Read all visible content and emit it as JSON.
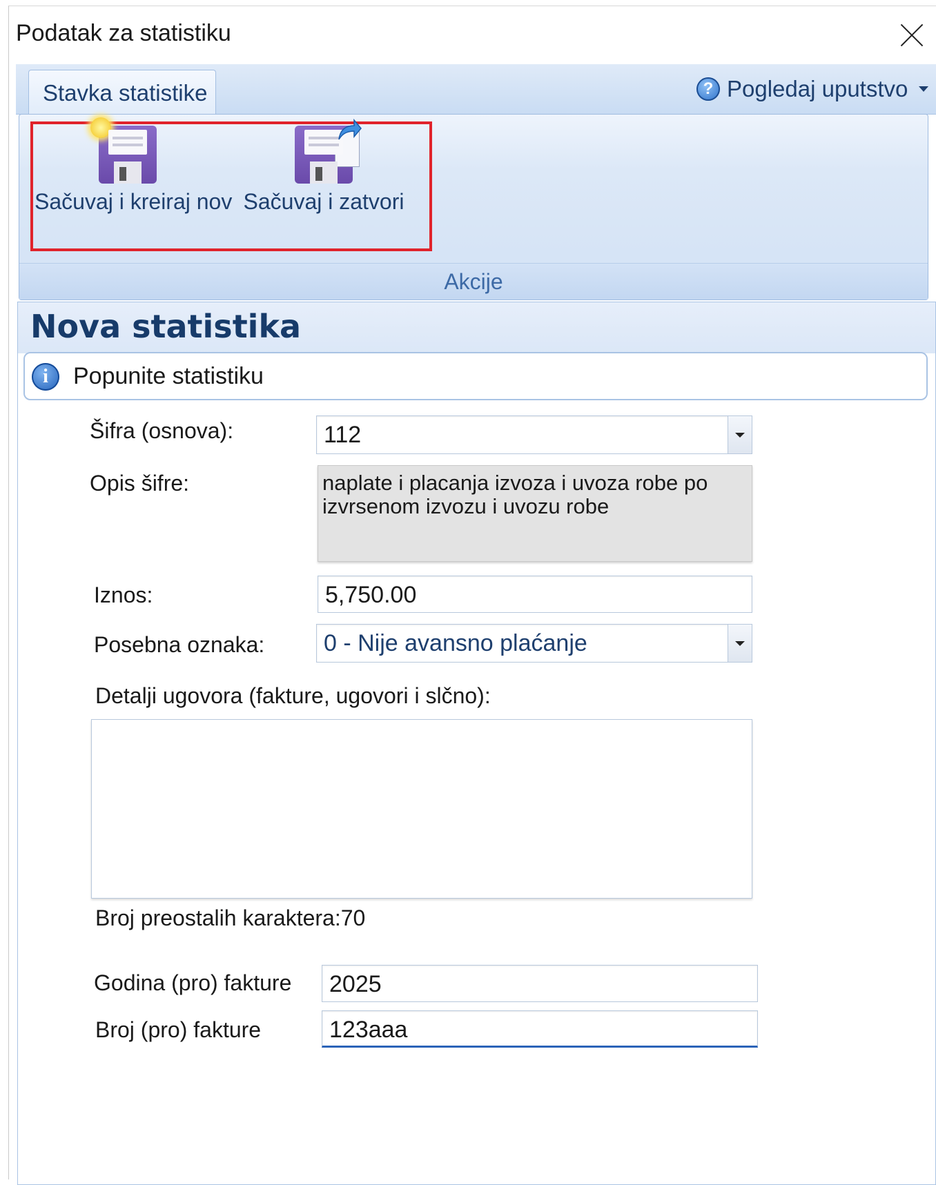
{
  "window": {
    "title": "Podatak za statistiku"
  },
  "ribbon": {
    "tab_label": "Stavka statistike",
    "help_label": "Pogledaj uputstvo",
    "group_label": "Akcije",
    "buttons": [
      {
        "label": "Sačuvaj i kreiraj nov",
        "icon": "save-new-icon"
      },
      {
        "label": "Sačuvaj i zatvori",
        "icon": "save-close-icon"
      }
    ],
    "highlight_color": "#e0232b"
  },
  "form": {
    "title": "Nova statistika",
    "info_text": "Popunite statistiku",
    "sifra_label": "Šifra (osnova):",
    "sifra_value": "112",
    "opis_label": "Opis šifre:",
    "opis_value": "naplate i placanja izvoza i uvoza robe po izvrsenom izvozu i uvozu robe",
    "iznos_label": "Iznos:",
    "iznos_value": "5,750.00",
    "oznaka_label": "Posebna oznaka:",
    "oznaka_value": "0 - Nije avansno plaćanje",
    "detalji_label": "Detalji ugovora (fakture, ugovori i slčno):",
    "detalji_value": "",
    "remaining_label": "Broj preostalih karaktera:",
    "remaining_count": "70",
    "godina_label": "Godina (pro) fakture",
    "godina_value": "2025",
    "broj_label": "Broj (pro) fakture",
    "broj_value": "123aaa"
  }
}
